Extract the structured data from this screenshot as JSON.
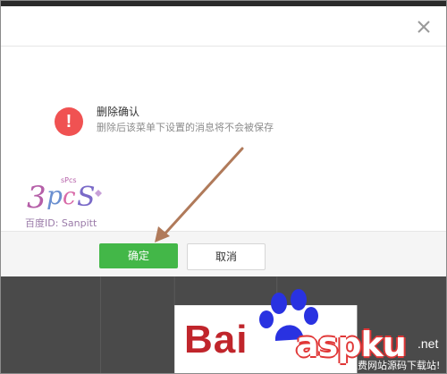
{
  "dialog": {
    "close_icon": "close-icon",
    "title": "删除确认",
    "message": "删除后该菜单下设置的消息将不会被保存",
    "warning_icon": "exclamation-icon",
    "warning_symbol": "!",
    "ok_label": "确定",
    "cancel_label": "取消",
    "colors": {
      "ok_button": "#43b748",
      "warning_circle": "#f05252",
      "arrow": "#b07a5a"
    }
  },
  "watermark": {
    "id_text": "百度ID: Sanpitt"
  },
  "background": {
    "baidu_text": "Bai",
    "aspku_text": "aspku",
    "aspku_suffix": ".net",
    "aspku_tagline": "免费网站源码下载站!"
  }
}
